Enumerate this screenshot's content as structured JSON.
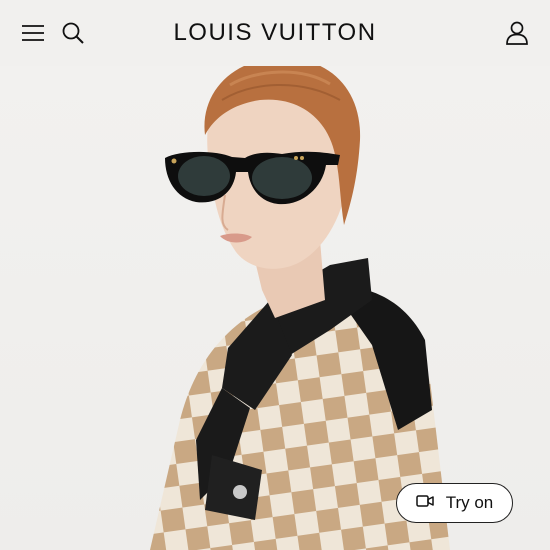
{
  "header": {
    "brand": "LOUIS VUITTON",
    "icons": [
      "menu-icon",
      "search-icon",
      "account-icon"
    ]
  },
  "hero": {
    "image": "model-wearing-sunglasses"
  },
  "try_on": {
    "label": "Try on",
    "icon": "video-camera-icon"
  },
  "colors": {
    "background": "#f1f0ee",
    "text": "#111111",
    "button_bg": "#ffffff",
    "button_border": "#222222"
  }
}
